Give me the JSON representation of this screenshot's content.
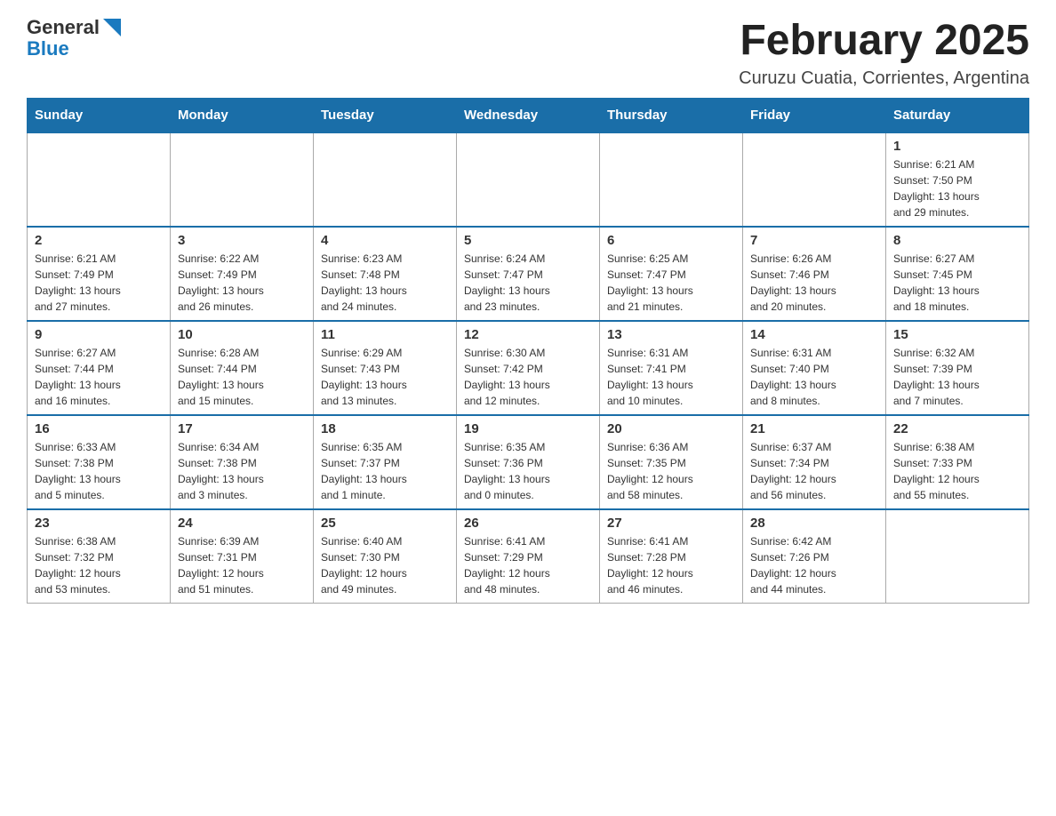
{
  "header": {
    "logo": {
      "line1": "General",
      "line2": "Blue"
    },
    "month_title": "February 2025",
    "location": "Curuzu Cuatia, Corrientes, Argentina"
  },
  "days_of_week": [
    "Sunday",
    "Monday",
    "Tuesday",
    "Wednesday",
    "Thursday",
    "Friday",
    "Saturday"
  ],
  "weeks": [
    {
      "days": [
        {
          "number": "",
          "info": ""
        },
        {
          "number": "",
          "info": ""
        },
        {
          "number": "",
          "info": ""
        },
        {
          "number": "",
          "info": ""
        },
        {
          "number": "",
          "info": ""
        },
        {
          "number": "",
          "info": ""
        },
        {
          "number": "1",
          "info": "Sunrise: 6:21 AM\nSunset: 7:50 PM\nDaylight: 13 hours\nand 29 minutes."
        }
      ]
    },
    {
      "days": [
        {
          "number": "2",
          "info": "Sunrise: 6:21 AM\nSunset: 7:49 PM\nDaylight: 13 hours\nand 27 minutes."
        },
        {
          "number": "3",
          "info": "Sunrise: 6:22 AM\nSunset: 7:49 PM\nDaylight: 13 hours\nand 26 minutes."
        },
        {
          "number": "4",
          "info": "Sunrise: 6:23 AM\nSunset: 7:48 PM\nDaylight: 13 hours\nand 24 minutes."
        },
        {
          "number": "5",
          "info": "Sunrise: 6:24 AM\nSunset: 7:47 PM\nDaylight: 13 hours\nand 23 minutes."
        },
        {
          "number": "6",
          "info": "Sunrise: 6:25 AM\nSunset: 7:47 PM\nDaylight: 13 hours\nand 21 minutes."
        },
        {
          "number": "7",
          "info": "Sunrise: 6:26 AM\nSunset: 7:46 PM\nDaylight: 13 hours\nand 20 minutes."
        },
        {
          "number": "8",
          "info": "Sunrise: 6:27 AM\nSunset: 7:45 PM\nDaylight: 13 hours\nand 18 minutes."
        }
      ]
    },
    {
      "days": [
        {
          "number": "9",
          "info": "Sunrise: 6:27 AM\nSunset: 7:44 PM\nDaylight: 13 hours\nand 16 minutes."
        },
        {
          "number": "10",
          "info": "Sunrise: 6:28 AM\nSunset: 7:44 PM\nDaylight: 13 hours\nand 15 minutes."
        },
        {
          "number": "11",
          "info": "Sunrise: 6:29 AM\nSunset: 7:43 PM\nDaylight: 13 hours\nand 13 minutes."
        },
        {
          "number": "12",
          "info": "Sunrise: 6:30 AM\nSunset: 7:42 PM\nDaylight: 13 hours\nand 12 minutes."
        },
        {
          "number": "13",
          "info": "Sunrise: 6:31 AM\nSunset: 7:41 PM\nDaylight: 13 hours\nand 10 minutes."
        },
        {
          "number": "14",
          "info": "Sunrise: 6:31 AM\nSunset: 7:40 PM\nDaylight: 13 hours\nand 8 minutes."
        },
        {
          "number": "15",
          "info": "Sunrise: 6:32 AM\nSunset: 7:39 PM\nDaylight: 13 hours\nand 7 minutes."
        }
      ]
    },
    {
      "days": [
        {
          "number": "16",
          "info": "Sunrise: 6:33 AM\nSunset: 7:38 PM\nDaylight: 13 hours\nand 5 minutes."
        },
        {
          "number": "17",
          "info": "Sunrise: 6:34 AM\nSunset: 7:38 PM\nDaylight: 13 hours\nand 3 minutes."
        },
        {
          "number": "18",
          "info": "Sunrise: 6:35 AM\nSunset: 7:37 PM\nDaylight: 13 hours\nand 1 minute."
        },
        {
          "number": "19",
          "info": "Sunrise: 6:35 AM\nSunset: 7:36 PM\nDaylight: 13 hours\nand 0 minutes."
        },
        {
          "number": "20",
          "info": "Sunrise: 6:36 AM\nSunset: 7:35 PM\nDaylight: 12 hours\nand 58 minutes."
        },
        {
          "number": "21",
          "info": "Sunrise: 6:37 AM\nSunset: 7:34 PM\nDaylight: 12 hours\nand 56 minutes."
        },
        {
          "number": "22",
          "info": "Sunrise: 6:38 AM\nSunset: 7:33 PM\nDaylight: 12 hours\nand 55 minutes."
        }
      ]
    },
    {
      "days": [
        {
          "number": "23",
          "info": "Sunrise: 6:38 AM\nSunset: 7:32 PM\nDaylight: 12 hours\nand 53 minutes."
        },
        {
          "number": "24",
          "info": "Sunrise: 6:39 AM\nSunset: 7:31 PM\nDaylight: 12 hours\nand 51 minutes."
        },
        {
          "number": "25",
          "info": "Sunrise: 6:40 AM\nSunset: 7:30 PM\nDaylight: 12 hours\nand 49 minutes."
        },
        {
          "number": "26",
          "info": "Sunrise: 6:41 AM\nSunset: 7:29 PM\nDaylight: 12 hours\nand 48 minutes."
        },
        {
          "number": "27",
          "info": "Sunrise: 6:41 AM\nSunset: 7:28 PM\nDaylight: 12 hours\nand 46 minutes."
        },
        {
          "number": "28",
          "info": "Sunrise: 6:42 AM\nSunset: 7:26 PM\nDaylight: 12 hours\nand 44 minutes."
        },
        {
          "number": "",
          "info": ""
        }
      ]
    }
  ]
}
